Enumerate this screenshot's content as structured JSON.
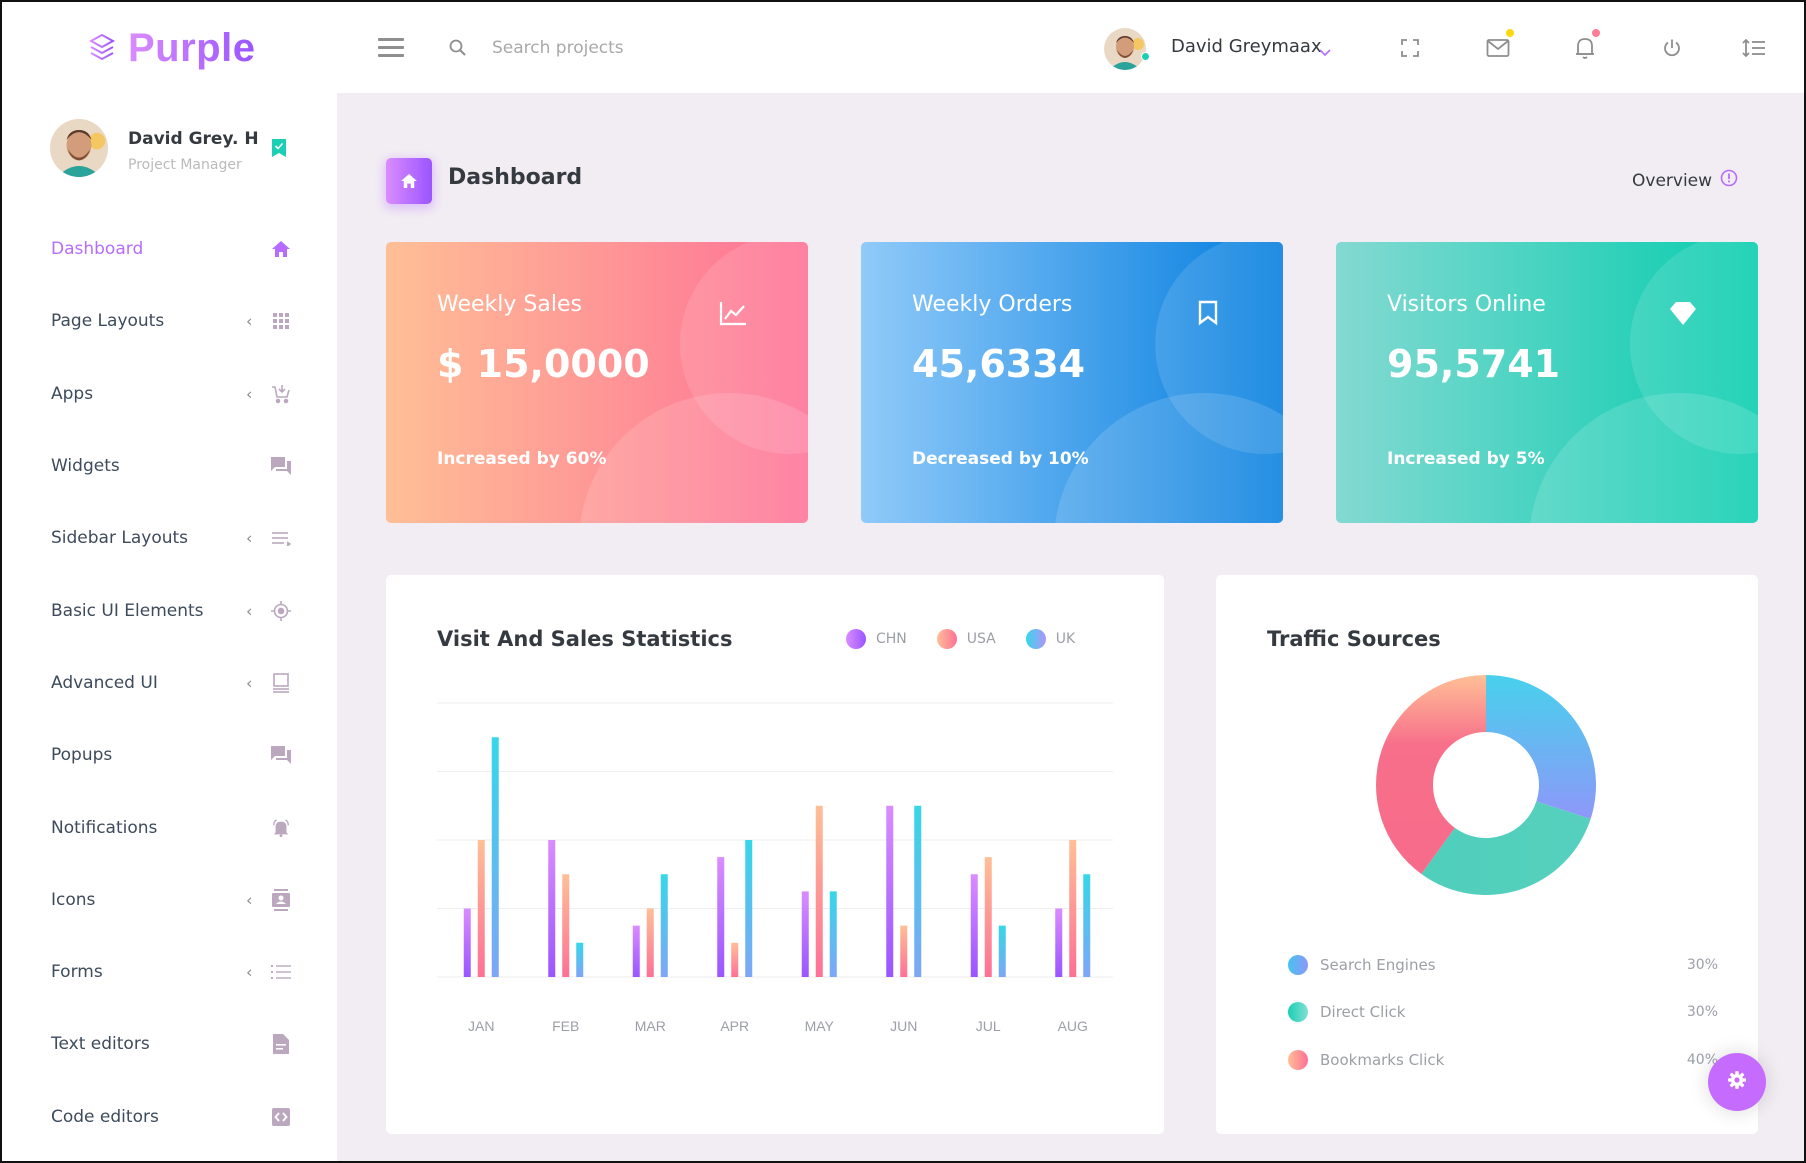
{
  "header": {
    "brand": "Purple",
    "search_placeholder": "Search projects",
    "search_value": "",
    "user_name": "David Greymaax",
    "icons": [
      "fullscreen-icon",
      "mail-icon",
      "bell-icon",
      "power-icon",
      "menu-lines-icon"
    ],
    "mail_badge_color": "#fed713",
    "bell_badge_color": "#fe7c96"
  },
  "sidebar": {
    "profile": {
      "name": "David Grey. H",
      "role": "Project Manager"
    },
    "items": [
      {
        "label": "Dashboard",
        "icon": "home-icon",
        "active": true,
        "expandable": false
      },
      {
        "label": "Page Layouts",
        "icon": "grid-icon",
        "active": false,
        "expandable": true
      },
      {
        "label": "Apps",
        "icon": "cart-icon",
        "active": false,
        "expandable": true
      },
      {
        "label": "Widgets",
        "icon": "forum-icon",
        "active": false,
        "expandable": false
      },
      {
        "label": "Sidebar Layouts",
        "icon": "playlist-icon",
        "active": false,
        "expandable": true
      },
      {
        "label": "Basic UI Elements",
        "icon": "crosshairs-icon",
        "active": false,
        "expandable": true
      },
      {
        "label": "Advanced UI",
        "icon": "monitor-icon",
        "active": false,
        "expandable": true
      },
      {
        "label": "Popups",
        "icon": "forum-icon",
        "active": false,
        "expandable": false
      },
      {
        "label": "Notifications",
        "icon": "bell-ring-icon",
        "active": false,
        "expandable": false
      },
      {
        "label": "Icons",
        "icon": "contacts-icon",
        "active": false,
        "expandable": true
      },
      {
        "label": "Forms",
        "icon": "list-icon",
        "active": false,
        "expandable": true
      },
      {
        "label": "Text editors",
        "icon": "document-icon",
        "active": false,
        "expandable": false
      },
      {
        "label": "Code editors",
        "icon": "code-icon",
        "active": false,
        "expandable": false
      }
    ]
  },
  "page": {
    "title": "Dashboard",
    "overview_label": "Overview"
  },
  "cards": [
    {
      "title": "Weekly Sales",
      "value": "$ 15,0000",
      "sub": "Increased by 60%",
      "icon": "chart-line-icon"
    },
    {
      "title": "Weekly Orders",
      "value": "45,6334",
      "sub": "Decreased by 10%",
      "icon": "bookmark-icon"
    },
    {
      "title": "Visitors Online",
      "value": "95,5741",
      "sub": "Increased by 5%",
      "icon": "diamond-icon"
    }
  ],
  "colors": {
    "accent": "#b66dff",
    "chn": [
      "#da8cff",
      "#9a55ff"
    ],
    "usa": [
      "#ffbf96",
      "#fe7096"
    ],
    "uk": [
      "#36d7e8",
      "#b194fa"
    ],
    "search_engines": [
      "#47c1f0",
      "#8e97f9"
    ],
    "direct_click": [
      "#1bcfb4",
      "#83e0d4"
    ],
    "bookmarks_click": [
      "#ffbf96",
      "#fe7096"
    ]
  },
  "chart_data": [
    {
      "type": "bar",
      "title": "Visit And Sales Statistics",
      "categories": [
        "JAN",
        "FEB",
        "MAR",
        "APR",
        "MAY",
        "JUN",
        "JUL",
        "AUG"
      ],
      "series": [
        {
          "name": "CHN",
          "values": [
            10,
            20,
            7.5,
            17.5,
            12.5,
            25,
            15,
            10
          ]
        },
        {
          "name": "USA",
          "values": [
            20,
            15,
            10,
            5,
            25,
            7.5,
            17.5,
            20
          ]
        },
        {
          "name": "UK",
          "values": [
            35,
            5,
            15,
            20,
            12.5,
            25,
            7.5,
            15
          ]
        }
      ],
      "ylim": [
        0,
        40
      ],
      "gridlines": [
        0,
        10,
        20,
        30,
        40
      ],
      "grid": true,
      "legend": "top-right",
      "xlabel": "",
      "ylabel": ""
    },
    {
      "type": "pie",
      "title": "Traffic Sources",
      "donut": true,
      "categories": [
        "Search Engines",
        "Direct Click",
        "Bookmarks Click"
      ],
      "values": [
        30,
        30,
        40
      ],
      "labels": [
        "30%",
        "30%",
        "40%"
      ],
      "legend": "bottom"
    }
  ]
}
